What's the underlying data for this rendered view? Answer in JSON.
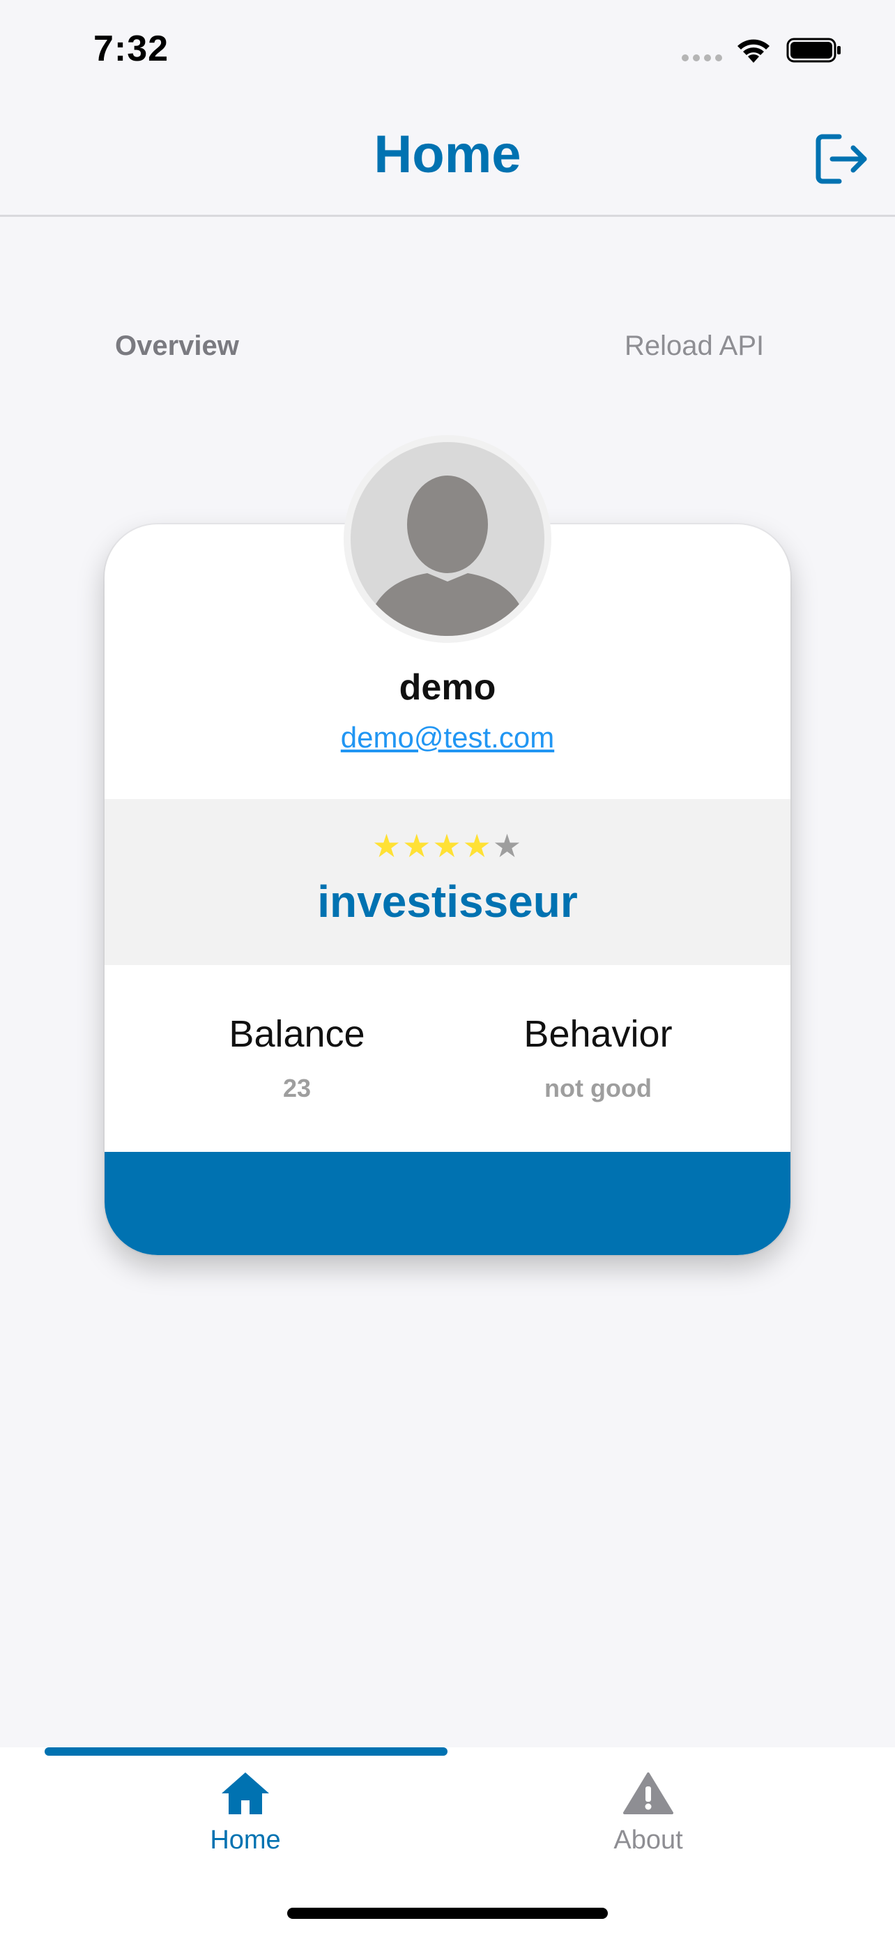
{
  "status_bar": {
    "time": "7:32"
  },
  "header": {
    "title": "Home",
    "logout_icon": "logout-icon"
  },
  "tabs": {
    "overview": "Overview",
    "reload": "Reload API"
  },
  "profile": {
    "name": "demo",
    "email": "demo@test.com",
    "rating": 4,
    "rating_max": 5,
    "rank": "investisseur",
    "stats": {
      "balance_label": "Balance",
      "balance_value": "23",
      "behavior_label": "Behavior",
      "behavior_value": "not good"
    }
  },
  "tabbar": {
    "home_label": "Home",
    "home_icon": "house-icon",
    "about_label": "About",
    "about_icon": "warning-icon"
  },
  "colors": {
    "accent": "#0072b1",
    "link": "#2196f3",
    "star_full": "#ffe135",
    "star_empty": "#9e9e9e",
    "background": "#f6f6f9"
  }
}
